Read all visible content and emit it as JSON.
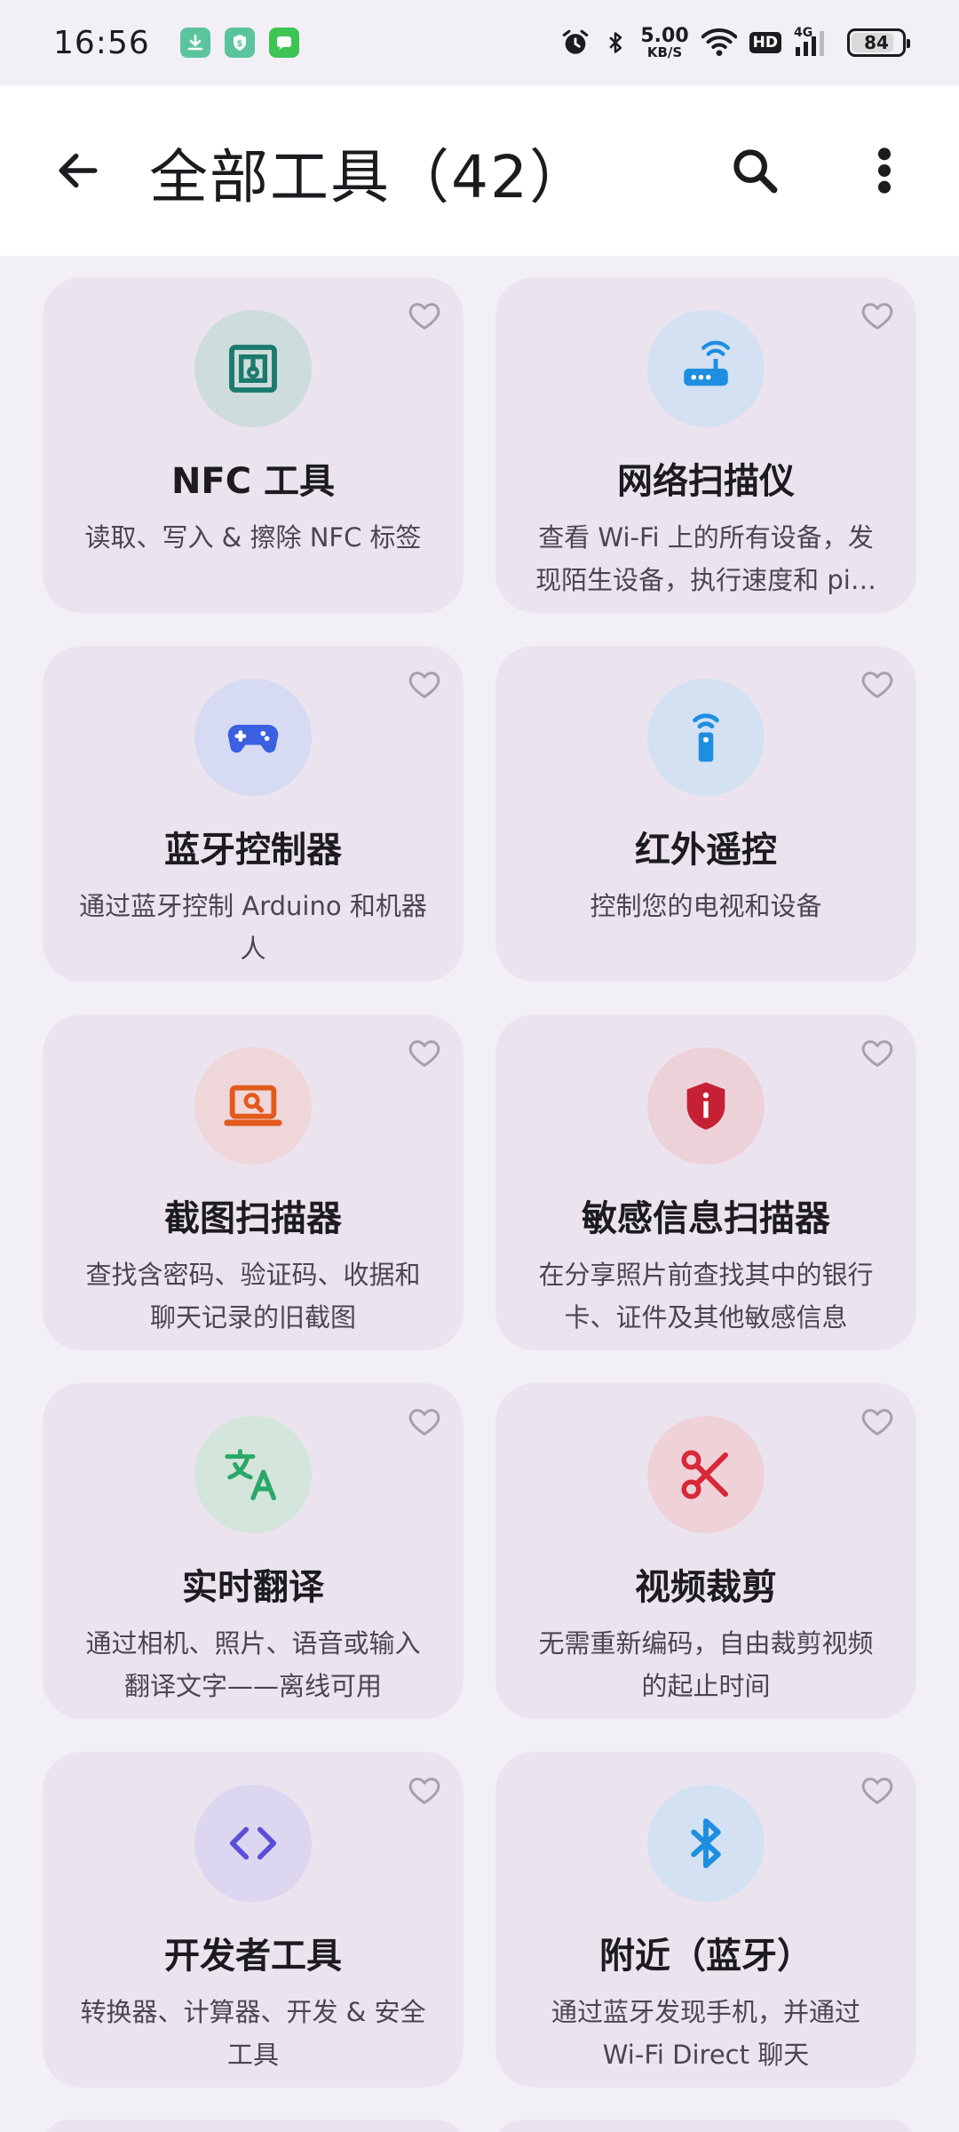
{
  "status_bar": {
    "time": "16:56",
    "net_speed_value": "5.00",
    "net_speed_unit": "KB/S",
    "hd": "HD",
    "network_type": "4G",
    "battery": "84",
    "battery_fraction": 0.84
  },
  "app_bar": {
    "title": "全部工具（42）"
  },
  "tools": [
    {
      "title": "NFC 工具",
      "desc": "读取、写入 & 擦除 NFC 标签",
      "icon": "nfc-icon",
      "circle": "#cfdcdc",
      "color": "#1b7a6e"
    },
    {
      "title": "网络扫描仪",
      "desc": "查看 Wi-Fi 上的所有设备，发现陌生设备，执行速度和 pi…",
      "icon": "router-icon",
      "circle": "#d3e1f3",
      "color": "#1e8fe0"
    },
    {
      "title": "蓝牙控制器",
      "desc": "通过蓝牙控制 Arduino 和机器人",
      "icon": "gamepad-icon",
      "circle": "#d6daf3",
      "color": "#3a5fe0"
    },
    {
      "title": "红外遥控",
      "desc": "控制您的电视和设备",
      "icon": "remote-icon",
      "circle": "#d3e1f3",
      "color": "#1e8fe0"
    },
    {
      "title": "截图扫描器",
      "desc": "查找含密码、验证码、收据和聊天记录的旧截图",
      "icon": "laptop-search-icon",
      "circle": "#efd6d9",
      "color": "#e25a1b"
    },
    {
      "title": "敏感信息扫描器",
      "desc": "在分享照片前查找其中的银行卡、证件及其他敏感信息",
      "icon": "shield-info-icon",
      "circle": "#ecd2d8",
      "color": "#c62034"
    },
    {
      "title": "实时翻译",
      "desc": "通过相机、照片、语音或输入翻译文字——离线可用",
      "icon": "translate-icon",
      "circle": "#d4e5dc",
      "color": "#2aa868"
    },
    {
      "title": "视频裁剪",
      "desc": "无需重新编码，自由裁剪视频的起止时间",
      "icon": "scissors-icon",
      "circle": "#efd2d8",
      "color": "#d8283a"
    },
    {
      "title": "开发者工具",
      "desc": "转换器、计算器、开发 & 安全工具",
      "icon": "code-icon",
      "circle": "#dcd6f1",
      "color": "#5b4fd8"
    },
    {
      "title": "附近（蓝牙）",
      "desc": "通过蓝牙发现手机，并通过 Wi-Fi Direct 聊天",
      "icon": "bluetooth-icon",
      "circle": "#d3e1f3",
      "color": "#1e8fe0"
    }
  ]
}
